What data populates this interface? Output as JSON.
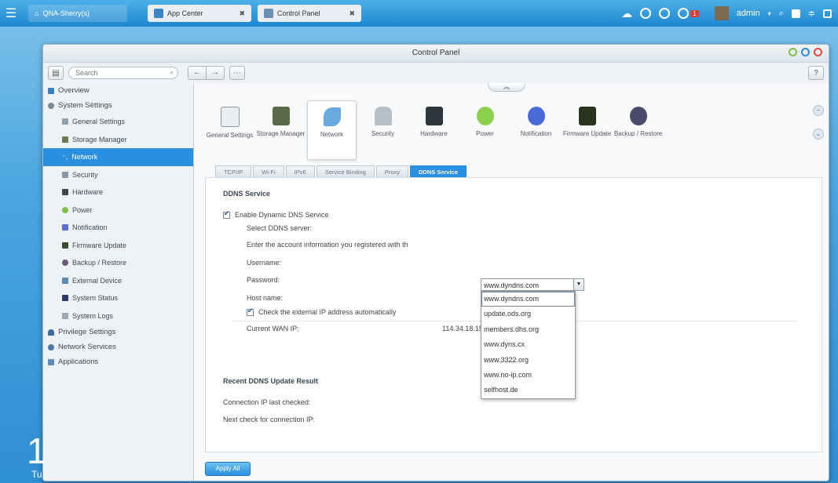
{
  "taskbar": {
    "home_tab": "QNA-Sherry(s)",
    "tabs": [
      {
        "label": "App Center",
        "color": "#3a86c8"
      },
      {
        "label": "Control Panel",
        "color": "#6b8fb4"
      }
    ],
    "notification_badge": "1",
    "user": "admin"
  },
  "window": {
    "title": "Control Panel",
    "search_placeholder": "Search"
  },
  "sidebar": {
    "items": [
      {
        "label": "Overview",
        "level": "top",
        "color": "#3a7fc4"
      },
      {
        "label": "System Settings",
        "level": "top",
        "color": "#7a8a99"
      },
      {
        "label": "General Settings",
        "level": "sub",
        "color": "#8fa0b0"
      },
      {
        "label": "Storage Manager",
        "level": "sub",
        "color": "#6a7a55"
      },
      {
        "label": "Network",
        "level": "sub",
        "color": "#ffffff",
        "selected": true
      },
      {
        "label": "Security",
        "level": "sub",
        "color": "#8a96a2"
      },
      {
        "label": "Hardware",
        "level": "sub",
        "color": "#3a4550"
      },
      {
        "label": "Power",
        "level": "sub",
        "color": "#7ac24a"
      },
      {
        "label": "Notification",
        "level": "sub",
        "color": "#5a6fd0"
      },
      {
        "label": "Firmware Update",
        "level": "sub",
        "color": "#3a4a30"
      },
      {
        "label": "Backup / Restore",
        "level": "sub",
        "color": "#6a5a7a"
      },
      {
        "label": "External Device",
        "level": "sub",
        "color": "#5a8ab0"
      },
      {
        "label": "System Status",
        "level": "sub",
        "color": "#2a3a6a"
      },
      {
        "label": "System Logs",
        "level": "sub",
        "color": "#9aa6b2"
      },
      {
        "label": "Privilege Settings",
        "level": "top",
        "color": "#3a6aa0"
      },
      {
        "label": "Network Services",
        "level": "top",
        "color": "#4a7aa8"
      },
      {
        "label": "Applications",
        "level": "top",
        "color": "#5a8ac0"
      }
    ]
  },
  "icons": [
    {
      "label": "General Settings",
      "icon": "general-settings-icon",
      "color": "#e8eef2"
    },
    {
      "label": "Storage Manager",
      "icon": "storage-manager-icon",
      "color": "#5a6a48"
    },
    {
      "label": "Network",
      "icon": "network-icon",
      "color": "#6aa8e0",
      "selected": true
    },
    {
      "label": "Security",
      "icon": "security-icon",
      "color": "#b6bec6"
    },
    {
      "label": "Hardware",
      "icon": "hardware-icon",
      "color": "#2e353c"
    },
    {
      "label": "Power",
      "icon": "power-icon",
      "color": "#8ad04a"
    },
    {
      "label": "Notification",
      "icon": "notification-icon",
      "color": "#4a6ad8"
    },
    {
      "label": "Firmware Update",
      "icon": "firmware-update-icon",
      "color": "#2a3420"
    },
    {
      "label": "Backup / Restore",
      "icon": "backup-restore-icon",
      "color": "#4a4a6a"
    }
  ],
  "tabs": [
    "TCP/IP",
    "Wi-Fi",
    "IPv6",
    "Service Binding",
    "Proxy",
    "DDNS Service"
  ],
  "active_tab": "DDNS Service",
  "ddns": {
    "section_title": "DDNS Service",
    "enable_label": "Enable Dynamic DNS Service",
    "select_label": "Select DDNS server:",
    "selected_server": "www.dyndns.com",
    "account_info_label": "Enter the account information you registered with th",
    "username_label": "Username:",
    "password_label": "Password:",
    "hostname_label": "Host name:",
    "check_ip_label": "Check the external IP address automatically",
    "wan_ip_label": "Current WAN IP:",
    "wan_ip_value": "114.34.18.156",
    "server_options": [
      "www.dyndns.com",
      "update.ods.org",
      "members.dhs.org",
      "www.dyns.cx",
      "www.3322.org",
      "www.no-ip.com",
      "selfhost.de"
    ]
  },
  "recent": {
    "title": "Recent DDNS Update Result",
    "last_checked_label": "Connection IP last checked:",
    "next_check_label": "Next check for connection IP:"
  },
  "apply_label": "Apply All",
  "desktop_clock": {
    "big": "1",
    "small": "Tu"
  }
}
